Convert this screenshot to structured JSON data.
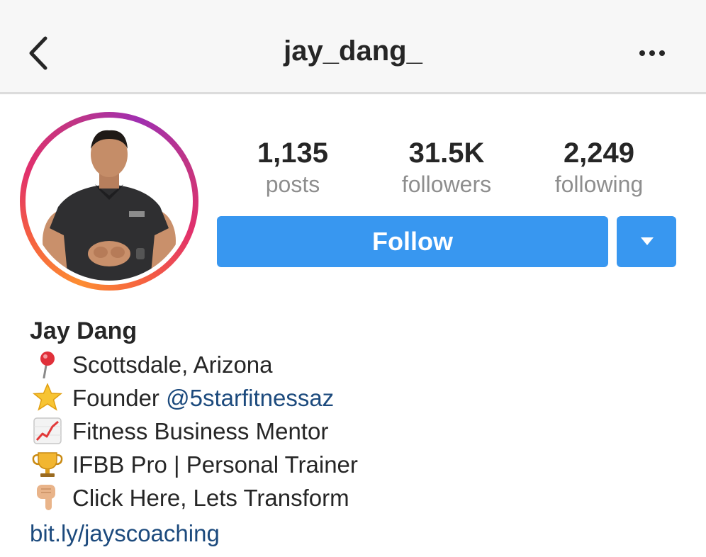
{
  "header": {
    "username": "jay_dang_",
    "back_icon": "chevron-left-icon",
    "more_icon": "ellipsis-icon"
  },
  "profile": {
    "avatar_icon": "profile-photo",
    "stats": {
      "posts": {
        "value": "1,135",
        "label": "posts"
      },
      "followers": {
        "value": "31.5K",
        "label": "followers"
      },
      "following": {
        "value": "2,249",
        "label": "following"
      }
    },
    "follow_label": "Follow",
    "dropdown_icon": "caret-down-icon"
  },
  "bio": {
    "name": "Jay Dang",
    "lines": [
      {
        "icon": "round-pushpin-icon",
        "text": "Scottsdale, Arizona"
      },
      {
        "icon": "star-icon",
        "text": "Founder ",
        "mention": "@5starfitnessaz"
      },
      {
        "icon": "chart-increasing-icon",
        "text": "Fitness Business Mentor"
      },
      {
        "icon": "trophy-icon",
        "text": "IFBB Pro | Personal Trainer"
      },
      {
        "icon": "pointing-down-hand-icon",
        "text": "Click Here, Lets Transform"
      }
    ],
    "link": "bit.ly/jayscoaching"
  },
  "colors": {
    "button_blue": "#3897f0",
    "link_blue": "#1c4a7d",
    "muted_gray": "#8e8e8e",
    "text_dark": "#262626",
    "header_bg": "#f7f7f7"
  }
}
